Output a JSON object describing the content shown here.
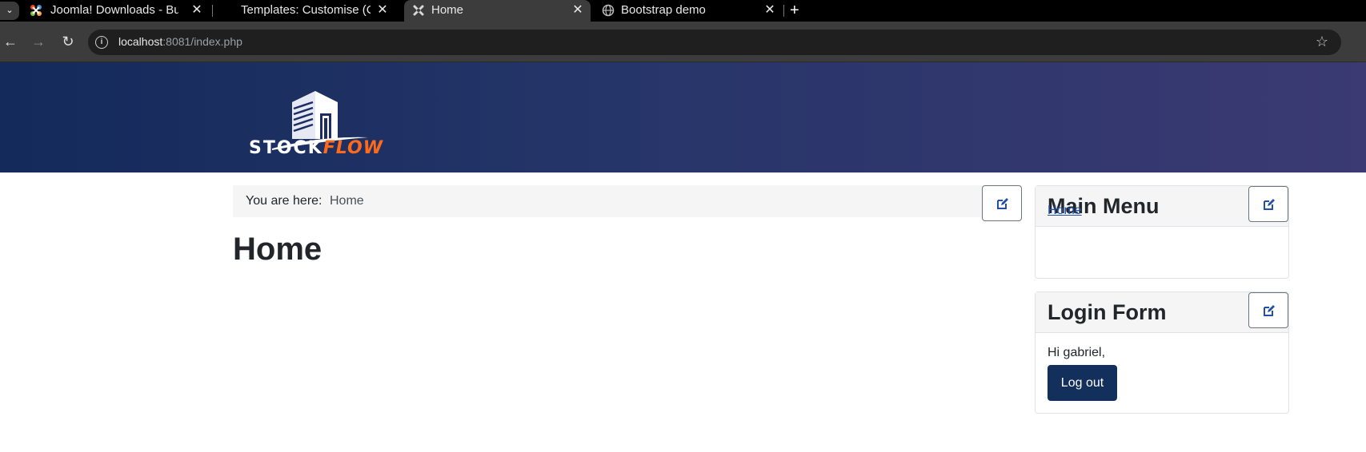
{
  "browser": {
    "tabs": [
      {
        "title": "Joomla! Downloads - Bui",
        "active": false,
        "favicon": "joomla-icon"
      },
      {
        "title": "Templates: Customise (C",
        "active": false,
        "favicon": "none"
      },
      {
        "title": "Home",
        "active": true,
        "favicon": "joomla-icon"
      },
      {
        "title": "Bootstrap demo",
        "active": false,
        "favicon": "globe-icon"
      }
    ],
    "new_tab": "+",
    "url_host": "localhost",
    "url_rest": ":8081/index.php"
  },
  "site": {
    "logo_text_main": "STOCK",
    "logo_text_accent": "FLOW",
    "colors": {
      "header_start": "#132a5a",
      "header_end": "#3b3a72",
      "accent": "#ff6a1a",
      "link": "#224faa",
      "button": "#132f5c"
    }
  },
  "breadcrumb": {
    "prefix": "You are here:",
    "current": "Home"
  },
  "main": {
    "title": "Home"
  },
  "sidebar": {
    "main_menu": {
      "title": "Main Menu",
      "items": [
        {
          "label": "Home"
        }
      ]
    },
    "login_form": {
      "title": "Login Form",
      "greeting": "Hi gabriel,",
      "logout_label": "Log out"
    }
  }
}
